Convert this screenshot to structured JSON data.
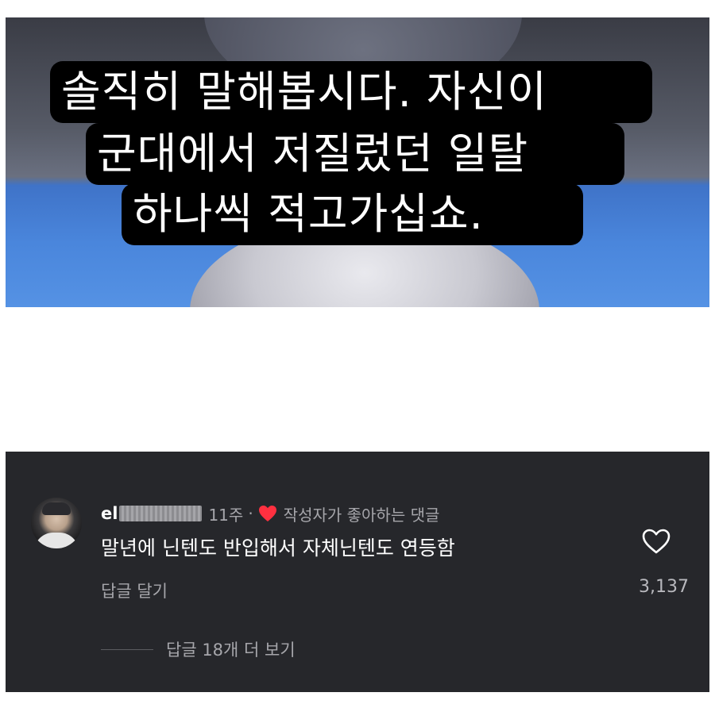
{
  "story": {
    "caption_lines": [
      "솔직히 말해봅시다. 자신이",
      "군대에서 저질렀던 일탈",
      "하나씩 적고가십쇼."
    ]
  },
  "comment": {
    "username_visible": "el",
    "time": "11주",
    "separator": "·",
    "author_liked_label": "작성자가 좋아하는 댓글",
    "text": "말년에 닌텐도 반입해서 자체닌텐도 연등함",
    "reply_label": "답글 달기",
    "like_count": "3,137",
    "more_replies_label": "답글 18개 더 보기",
    "icons": {
      "author_heart": "heart-filled-icon",
      "like": "heart-outline-icon"
    },
    "colors": {
      "panel_bg": "#26272b",
      "heart_red": "#ff3040",
      "secondary_text": "#a6a6ab"
    }
  }
}
